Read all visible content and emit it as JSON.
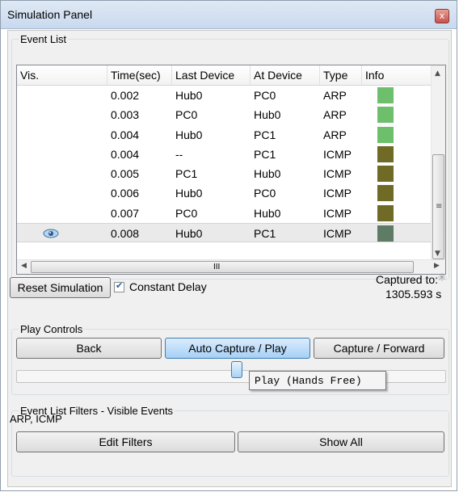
{
  "window": {
    "title": "Simulation Panel",
    "close_glyph": "x"
  },
  "event_list": {
    "legend": "Event List",
    "columns": [
      "Vis.",
      "Time(sec)",
      "Last Device",
      "At Device",
      "Type",
      "Info"
    ],
    "rows": [
      {
        "vis": false,
        "time": "0.002",
        "last": "Hub0",
        "at": "PC0",
        "type": "ARP",
        "color": "#6dbf6b"
      },
      {
        "vis": false,
        "time": "0.003",
        "last": "PC0",
        "at": "Hub0",
        "type": "ARP",
        "color": "#6dbf6b"
      },
      {
        "vis": false,
        "time": "0.004",
        "last": "Hub0",
        "at": "PC1",
        "type": "ARP",
        "color": "#6dbf6b"
      },
      {
        "vis": false,
        "time": "0.004",
        "last": "--",
        "at": "PC1",
        "type": "ICMP",
        "color": "#6f6a25"
      },
      {
        "vis": false,
        "time": "0.005",
        "last": "PC1",
        "at": "Hub0",
        "type": "ICMP",
        "color": "#6f6a25"
      },
      {
        "vis": false,
        "time": "0.006",
        "last": "Hub0",
        "at": "PC0",
        "type": "ICMP",
        "color": "#6f6a25"
      },
      {
        "vis": false,
        "time": "0.007",
        "last": "PC0",
        "at": "Hub0",
        "type": "ICMP",
        "color": "#6f6a25"
      },
      {
        "vis": true,
        "time": "0.008",
        "last": "Hub0",
        "at": "PC1",
        "type": "ICMP",
        "color": "#5e7b66",
        "selected": true
      }
    ],
    "hscroll_grip": "III"
  },
  "controls": {
    "reset_label": "Reset Simulation",
    "constant_delay_label": "Constant Delay",
    "constant_delay_checked": true,
    "captured_label": "Captured to:",
    "captured_value": "1305.593 s"
  },
  "play_controls": {
    "legend": "Play Controls",
    "back_label": "Back",
    "auto_label": "Auto Capture / Play",
    "forward_label": "Capture / Forward",
    "tooltip": "Play (Hands Free)"
  },
  "filters": {
    "legend": "Event List Filters - Visible Events",
    "visible": "ARP, ICMP",
    "edit_label": "Edit Filters",
    "show_all_label": "Show All"
  }
}
